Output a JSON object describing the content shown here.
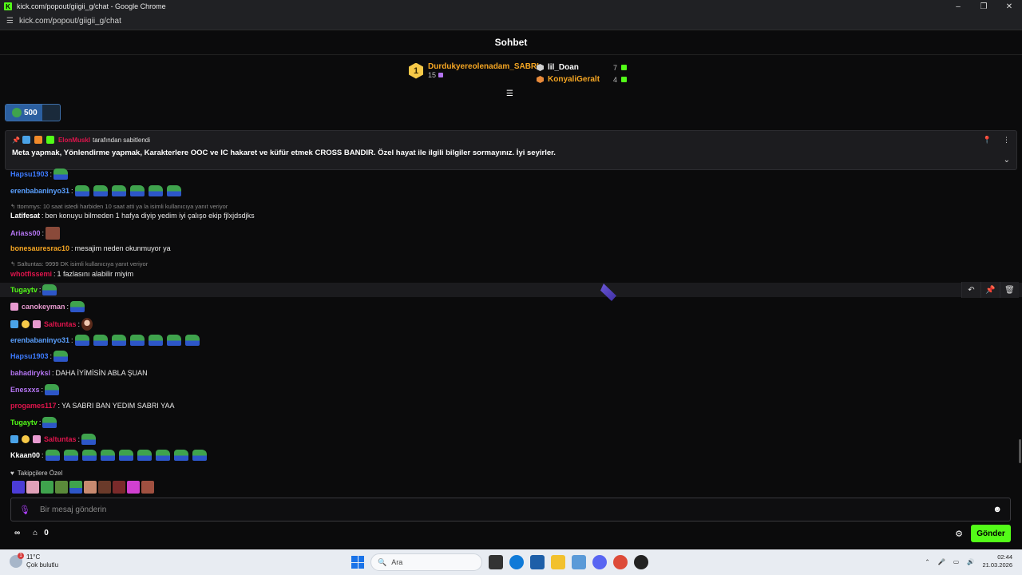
{
  "window": {
    "title": "kick.com/popout/giigii_g/chat - Google Chrome",
    "url": "kick.com/popout/giigii_g/chat",
    "controls": [
      "–",
      "❐",
      "✕"
    ]
  },
  "header": {
    "title": "Sohbet"
  },
  "leaderboard": {
    "first": {
      "rank": "1",
      "name": "Durdukyereolenadam_SABRI",
      "count": "15"
    },
    "others": [
      {
        "name": "lil_Doan",
        "count": "7",
        "color": "#ffffff",
        "hex_color": "#d0d0d0"
      },
      {
        "name": "KonyaliGeralt",
        "count": "4",
        "color": "#f5a623",
        "hex_color": "#e88a3a"
      }
    ]
  },
  "goal": {
    "value": "500",
    "fill_fraction": 0.67
  },
  "pinned": {
    "by_user": "ElonMuskI",
    "by_suffix": "tarafından sabitlendi",
    "message": "Meta yapmak, Yönlendirme yapmak, Karakterlere OOC ve IC hakaret ve küfür etmek CROSS BANDIR. Özel hayat ile ilgili bilgiler sormayınız. İyi seyirler."
  },
  "messages": [
    {
      "user": "Hapsu1903",
      "color": "#3d7bff",
      "text": "",
      "emotes": 1
    },
    {
      "user": "erenbabaninyo31",
      "color": "#5aa0ff",
      "text": "",
      "emotes": 6
    },
    {
      "reply": "ttommys: 10 saat istedi harbiden 10 saat atti ya la isimli kullanıcıya yanıt veriyor"
    },
    {
      "user": "Latifesat",
      "color": "#ffffff",
      "text": "ben konuyu bilmeden 1 hafya diyip yedim iyi çalışo ekip fjlxjdsdjks",
      "emotes": 0
    },
    {
      "user": "Ariass00",
      "color": "#b374f0",
      "text": "",
      "emotes": 0
    },
    {
      "user": "bonesauresrac10",
      "color": "#f5a623",
      "text": "mesajim neden okunmuyor ya",
      "emotes": 0
    },
    {
      "reply": "Saltuntas: 9999 DK isimli kullanıcıya yanıt veriyor"
    },
    {
      "user": "whotfissemi",
      "color": "#e0144c",
      "text": "1 fazlasını alabilir miyim",
      "emotes": 0
    },
    {
      "user": "Tugaytv",
      "color": "#53fc18",
      "text": "",
      "emotes": 1
    },
    {
      "user": "canokeyman",
      "color": "#e89ad0",
      "text": "",
      "emotes": 1
    },
    {
      "user": "Saltuntas",
      "color": "#e0144c",
      "text": "",
      "emotes": 0
    },
    {
      "user": "erenbabaninyo31",
      "color": "#5aa0ff",
      "text": "",
      "emotes": 7
    },
    {
      "user": "Hapsu1903",
      "color": "#3d7bff",
      "text": "",
      "emotes": 1
    },
    {
      "user": "bahadiryksl",
      "color": "#b374f0",
      "text": "DAHA İYİMİSİN ABLA ŞUAN",
      "emotes": 0
    },
    {
      "user": "Enesxxs",
      "color": "#b374f0",
      "text": "",
      "emotes": 1
    },
    {
      "user": "progames117",
      "color": "#e0144c",
      "text": "YA SABRI BAN YEDIM SABRI YAA",
      "emotes": 0
    },
    {
      "user": "Tugaytv",
      "color": "#53fc18",
      "text": "",
      "emotes": 1
    },
    {
      "user": "Saltuntas",
      "color": "#e0144c",
      "text": "",
      "emotes": 1
    },
    {
      "user": "Kkaan00",
      "color": "#ffffff",
      "text": "",
      "emotes": 9
    }
  ],
  "followers_label": "Takipçilere Özel",
  "input": {
    "placeholder": "Bir mesaj gönderin"
  },
  "footer": {
    "points": "0",
    "send_label": "Gönder"
  },
  "taskbar": {
    "weather_temp": "11°C",
    "weather_desc": "Çok bulutlu",
    "weather_badge": "1",
    "search_label": "Ara",
    "time": "02:44",
    "date": "21.03.2026"
  },
  "colors": {
    "accent": "#53fc18",
    "background": "#0b0b0c"
  }
}
